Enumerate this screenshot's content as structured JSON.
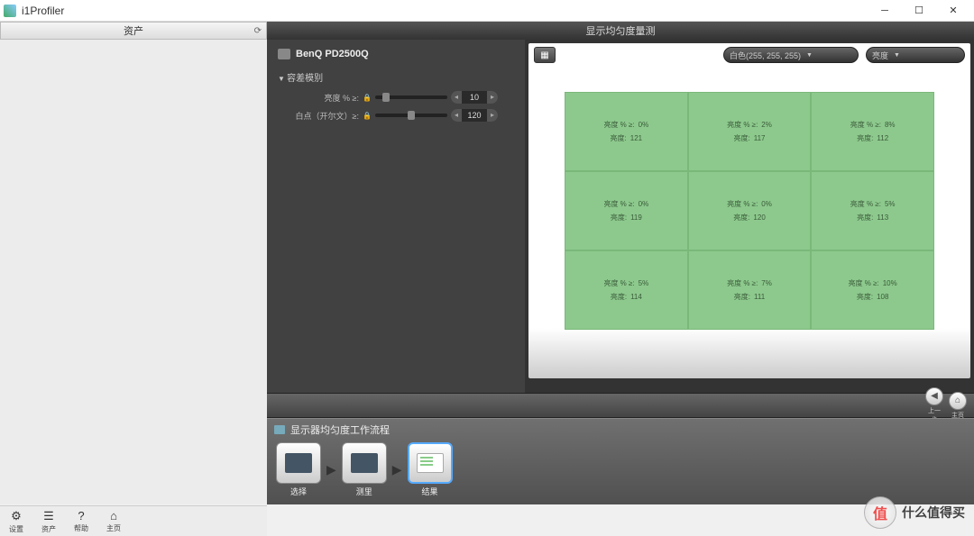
{
  "window": {
    "title": "i1Profiler"
  },
  "sidebar": {
    "header": "资产"
  },
  "main": {
    "title": "显示均匀度量测",
    "monitor_name": "BenQ PD2500Q",
    "section": "容差模别",
    "sliders": {
      "brightness": {
        "label": "亮度 % ≥:",
        "value": "10"
      },
      "whitepoint": {
        "label": "白点（开尔文）≥:",
        "value": "120"
      }
    },
    "dropdowns": {
      "color": "白色(255, 255, 255)",
      "mode": "亮度"
    },
    "cells": [
      {
        "d": "0%",
        "b": "121"
      },
      {
        "d": "2%",
        "b": "117"
      },
      {
        "d": "8%",
        "b": "112"
      },
      {
        "d": "0%",
        "b": "119"
      },
      {
        "d": "0%",
        "b": "120"
      },
      {
        "d": "5%",
        "b": "113"
      },
      {
        "d": "5%",
        "b": "114"
      },
      {
        "d": "7%",
        "b": "111"
      },
      {
        "d": "10%",
        "b": "108"
      }
    ],
    "cell_labels": {
      "delta": "亮度 % ≥:",
      "bright": "亮度:"
    },
    "nav": {
      "prev": "上一步",
      "home": "主页"
    }
  },
  "workflow": {
    "title": "显示器均匀度工作流程",
    "steps": [
      "选择",
      "测里",
      "结果"
    ]
  },
  "toolbar": {
    "items": [
      "设置",
      "资产",
      "帮助",
      "主页"
    ]
  },
  "watermark": {
    "icon": "值",
    "text": "什么值得买"
  }
}
